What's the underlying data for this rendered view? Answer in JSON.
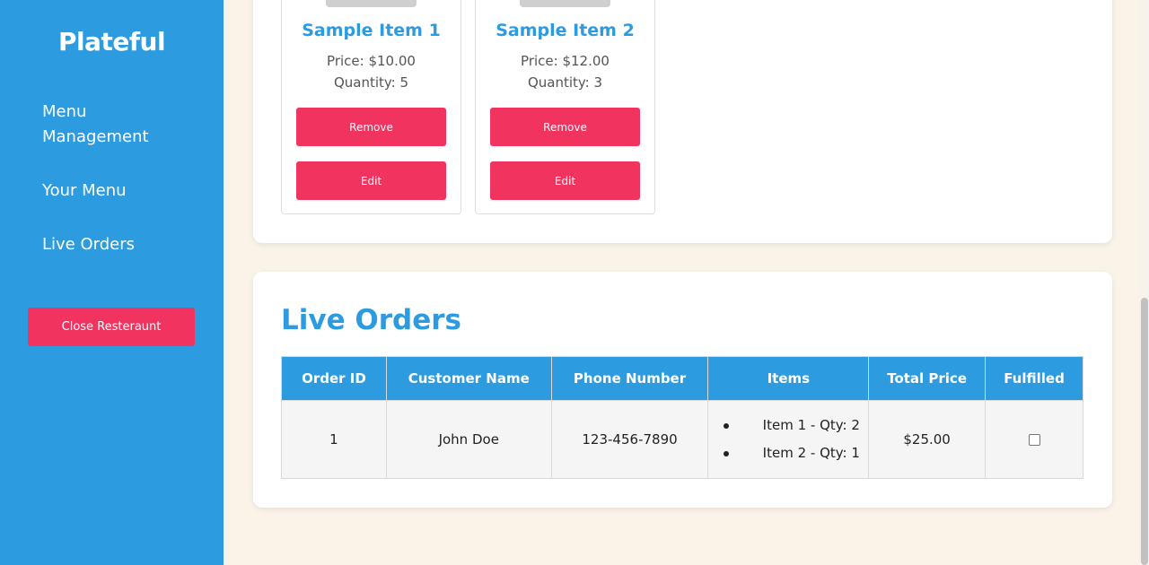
{
  "sidebar": {
    "brand": "Plateful",
    "nav": [
      {
        "label": "Menu Management"
      },
      {
        "label": "Your Menu"
      },
      {
        "label": "Live Orders"
      }
    ],
    "close_label": "Close Resteraunt"
  },
  "menu": {
    "items": [
      {
        "name": "Sample Item 1",
        "price": "Price: $10.00",
        "quantity": "Quantity: 5",
        "remove_label": "Remove",
        "edit_label": "Edit"
      },
      {
        "name": "Sample Item 2",
        "price": "Price: $12.00",
        "quantity": "Quantity: 3",
        "remove_label": "Remove",
        "edit_label": "Edit"
      }
    ]
  },
  "orders": {
    "title": "Live Orders",
    "columns": [
      "Order ID",
      "Customer Name",
      "Phone Number",
      "Items",
      "Total Price",
      "Fulfilled"
    ],
    "rows": [
      {
        "order_id": "1",
        "customer": "John Doe",
        "phone": "123-456-7890",
        "items": [
          "Item 1 - Qty: 2",
          "Item 2 - Qty: 1"
        ],
        "total": "$25.00",
        "fulfilled": false
      }
    ]
  },
  "colors": {
    "sidebar": "#2d9be0",
    "accent": "#f0345f",
    "page_bg": "#faf3e8",
    "header_text": "#2d9be0"
  }
}
